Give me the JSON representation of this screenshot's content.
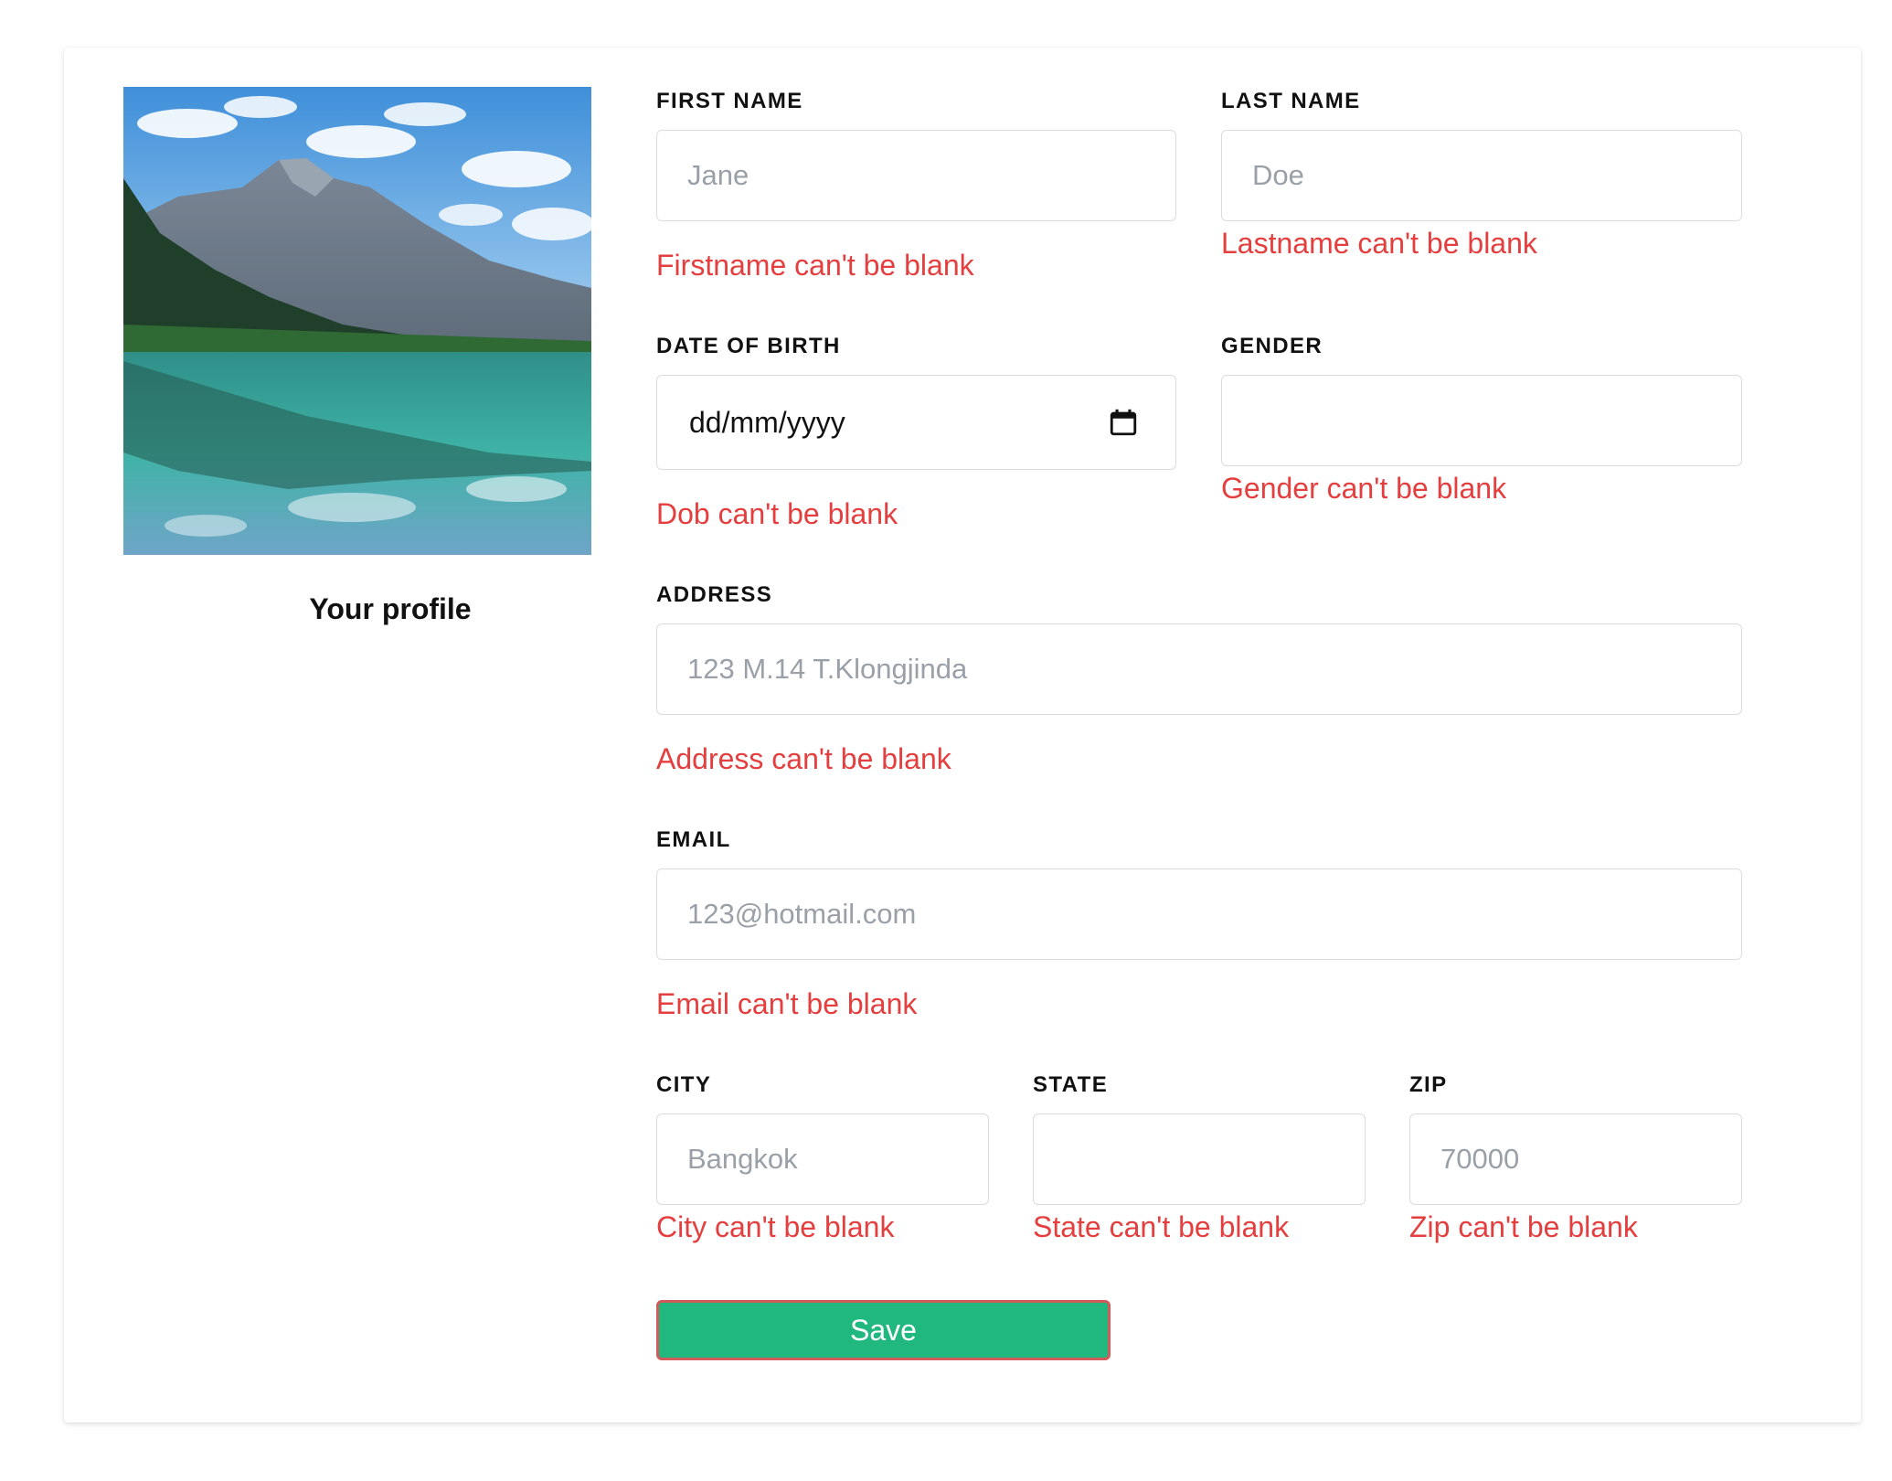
{
  "profile": {
    "caption": "Your profile",
    "image_icon": "landscape-photo"
  },
  "form": {
    "first_name": {
      "label": "FIRST NAME",
      "placeholder": "Jane",
      "value": "",
      "error": "Firstname can't be blank"
    },
    "last_name": {
      "label": "LAST NAME",
      "placeholder": "Doe",
      "value": "",
      "error": "Lastname can't be blank"
    },
    "dob": {
      "label": "DATE OF BIRTH",
      "display": "dd/mm/yyyy",
      "icon": "calendar-icon",
      "error": "Dob can't be blank"
    },
    "gender": {
      "label": "GENDER",
      "value": "",
      "error": "Gender can't be blank"
    },
    "address": {
      "label": "ADDRESS",
      "placeholder": "123 M.14 T.Klongjinda",
      "value": "",
      "error": "Address can't be blank"
    },
    "email": {
      "label": "EMAIL",
      "placeholder": "123@hotmail.com",
      "value": "",
      "error": "Email can't be blank"
    },
    "city": {
      "label": "CITY",
      "placeholder": "Bangkok",
      "value": "",
      "error": "City can't be blank"
    },
    "state": {
      "label": "STATE",
      "placeholder": "",
      "value": "",
      "error": "State can't be blank"
    },
    "zip": {
      "label": "ZIP",
      "placeholder": "70000",
      "value": "",
      "error": "Zip can't be blank"
    },
    "save_label": "Save"
  },
  "colors": {
    "error": "#e53e3e",
    "save_button": "#21b880",
    "save_border": "#d25a5a",
    "input_border": "#d9dce1"
  }
}
